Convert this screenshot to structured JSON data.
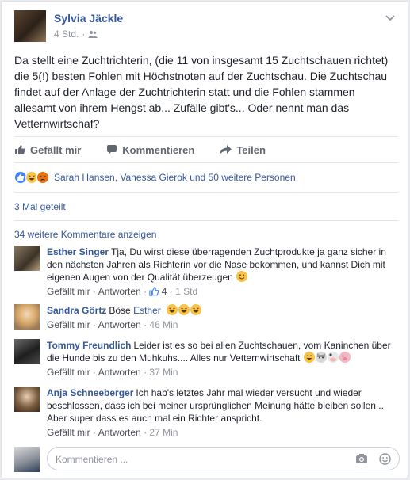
{
  "post": {
    "author": "Sylvia Jäckle",
    "time": "4 Std.",
    "text": "Da stellt eine Zuchtrichterin, (die 11 von insgesamt 15 Zuchtschauen richtet) die 5(!) besten Fohlen mit Höchstnoten auf der Zuchtschau. Die Zuchtschau findet auf der Anlage der Zuchtrichterin statt und die Fohlen stammen allesamt von ihrem Hengst ab... Zufälle gibt's... Oder nennt man das Vetternwirtschaf?",
    "icons": {
      "audience": "friends-icon",
      "menu": "chevron-down-icon"
    }
  },
  "actions": {
    "like": "Gefällt mir",
    "comment": "Kommentieren",
    "share": "Teilen"
  },
  "reactions": {
    "text": "Sarah Hansen, Vanessa Gierok und 50 weitere Personen",
    "types": [
      "like",
      "haha",
      "angry"
    ],
    "colors": {
      "like": "#4080ff",
      "haha": "#f7c34a",
      "angry": "#e9710f"
    }
  },
  "shares": "3 Mal geteilt",
  "more_comments": "34 weitere Kommentare anzeigen",
  "comments": [
    {
      "name": "Esther Singer",
      "text": "Tja, Du wirst diese überragenden Zuchtprodukte ja ganz sicher in den nächsten Jahren als Richterin vor die Nase bekommen, und kannst Dich mit eigenen Augen von der Qualität überzeugen",
      "emoji": [
        "smile"
      ],
      "like": "Gefällt mir",
      "reply": "Antworten",
      "likes": "4",
      "time": "1 Std"
    },
    {
      "name": "Sandra Görtz",
      "text": "Böse",
      "mention": "Esther",
      "emoji": [
        "laugh",
        "laugh",
        "laugh"
      ],
      "like": "Gefällt mir",
      "reply": "Antworten",
      "time": "46 Min"
    },
    {
      "name": "Tommy Freundlich",
      "text": "Leider ist es so bei allen Zuchtschauen, vom Kaninchen über die Hunde bis zu den Muhkuhs.... Alles nur Vetternwirtschaft",
      "emoji": [
        "grin",
        "cat",
        "cow",
        "pig"
      ],
      "like": "Gefällt mir",
      "reply": "Antworten",
      "time": "37 Min"
    },
    {
      "name": "Anja Schneeberger",
      "text": "Ich hab's letztes Jahr mal wieder versucht und wieder beschlossen, dass ich bei meiner ursprünglichen Meinung hätte bleiben sollen... Aber super dass es auch mal ein Richter anspricht.",
      "like": "Gefällt mir",
      "reply": "Antworten",
      "time": "27 Min"
    }
  ],
  "composer": {
    "placeholder": "Kommentieren ..."
  },
  "sep": "·"
}
